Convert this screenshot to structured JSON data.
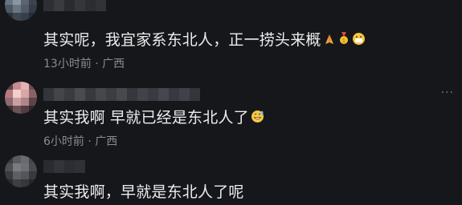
{
  "comments": [
    {
      "text": "其实呢，我宜家系东北人，正一捞头来概",
      "emojis": [
        "pray-icon",
        "medal-icon",
        "smile-mask-icon"
      ],
      "time": "13小时前",
      "separator": "·",
      "location": "广西"
    },
    {
      "text": "其实我啊 早就已经是东北人了",
      "emojis": [
        "grin-sweat-icon"
      ],
      "time": "6小时前",
      "separator": "·",
      "location": "广西"
    },
    {
      "text": "其实我啊，早就是东北人了呢",
      "emojis": [],
      "time": "",
      "separator": "",
      "location": ""
    }
  ],
  "colors": {
    "background": "#16171b",
    "text": "#ececee",
    "meta": "#8a8b90"
  },
  "more_label": "···"
}
